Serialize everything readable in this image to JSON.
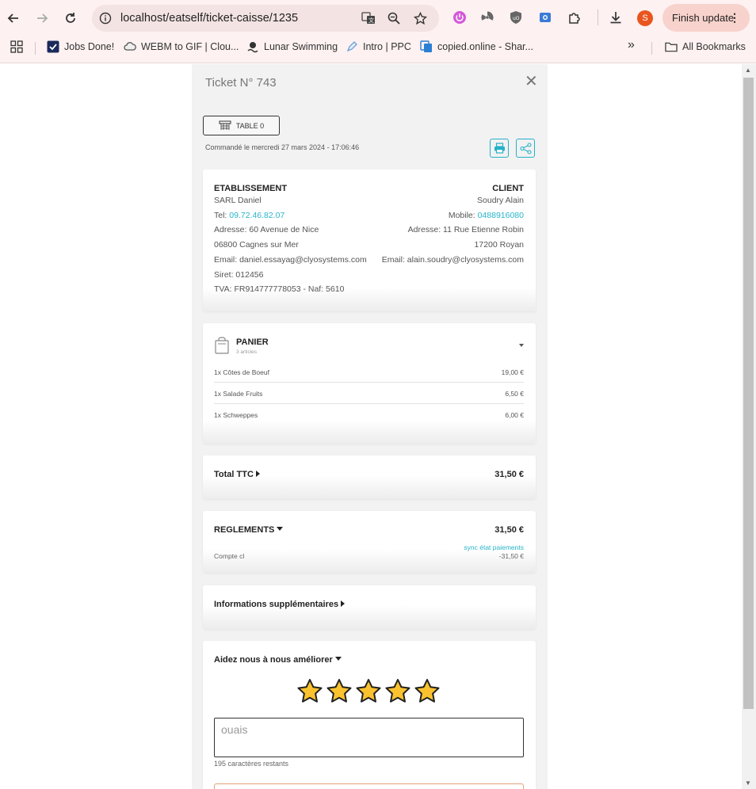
{
  "browser": {
    "url": "localhost/eatself/ticket-caisse/1235",
    "avatar_letter": "S",
    "finish_update_label": "Finish update",
    "bookmarks": [
      {
        "label": "Jobs Done!",
        "icon": "check-icon"
      },
      {
        "label": "WEBM to GIF | Clou...",
        "icon": "cloud-icon"
      },
      {
        "label": "Lunar Swimming",
        "icon": "swimmer-icon"
      },
      {
        "label": "Intro | PPC",
        "icon": "pen-icon"
      },
      {
        "label": "copied.online - Shar...",
        "icon": "copy-icon"
      }
    ],
    "all_bookmarks_label": "All Bookmarks",
    "overflow_label": "»"
  },
  "ticket": {
    "title": "Ticket  N° 743",
    "table_label": "TABLE 0",
    "order_date": "Commandé le mercredi 27 mars 2024 - 17:06:46"
  },
  "establishment": {
    "heading": "ETABLISSEMENT",
    "name": "SARL Daniel",
    "tel_label": "Tel: ",
    "tel": "09.72.46.82.07",
    "address": "Adresse: 60 Avenue de Nice",
    "city": "06800 Cagnes sur Mer",
    "email": "Email: daniel.essayag@clyosystems.com",
    "siret": "Siret: 012456",
    "tva": "TVA: FR914777778053 - Naf: 5610"
  },
  "client": {
    "heading": "CLIENT",
    "name": "Soudry Alain",
    "mobile_label": "Mobile: ",
    "mobile": "0488916080",
    "address": "Adresse: 11 Rue Etienne Robin",
    "city": "17200 Royan",
    "email": "Email: alain.soudry@clyosystems.com"
  },
  "basket": {
    "heading": "PANIER",
    "count": "3 articles",
    "items": [
      {
        "label": "1x Côtes de Boeuf",
        "price": "19,00 €"
      },
      {
        "label": "1x Salade Fruits",
        "price": "6,50 €"
      },
      {
        "label": "1x Schweppes",
        "price": "6,00 €"
      }
    ]
  },
  "total": {
    "label": "Total TTC",
    "value": "31,50 €"
  },
  "payments": {
    "label": "REGLEMENTS",
    "value": "31,50 €",
    "sync_link": "sync état paiements",
    "line_label": "Compte cl",
    "line_value": "-31,50 €"
  },
  "extra_info": {
    "label": "Informations supplémentaires"
  },
  "feedback": {
    "label": "Aidez nous à nous améliorer",
    "rating": 5,
    "rating_max": 5,
    "placeholder": "ouais",
    "chars_left": "195 caractères restants"
  },
  "colors": {
    "accent": "#27b5c9",
    "star": "#f9c22e",
    "chrome_bg": "#fdf1f1"
  }
}
